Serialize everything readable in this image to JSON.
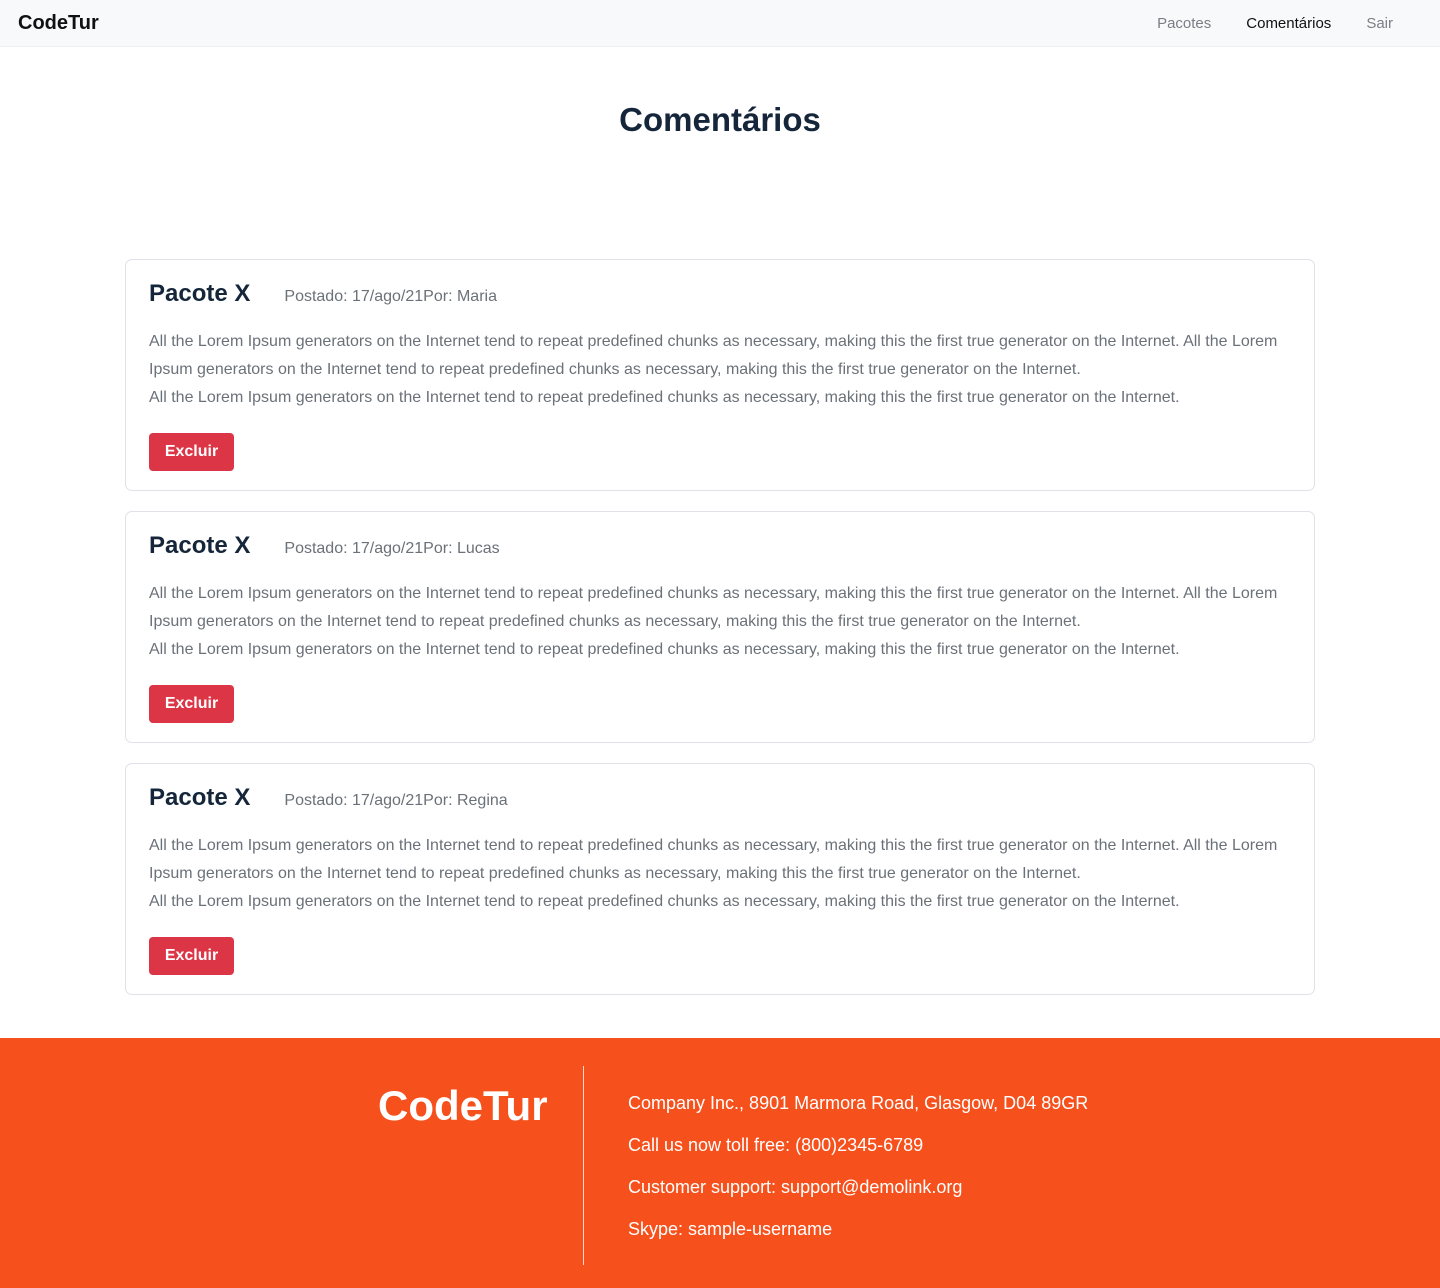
{
  "navbar": {
    "brand": "CodeTur",
    "links": [
      {
        "label": "Pacotes",
        "active": false
      },
      {
        "label": "Comentários",
        "active": true
      },
      {
        "label": "Sair",
        "active": false
      }
    ]
  },
  "page": {
    "title": "Comentários"
  },
  "comments": [
    {
      "title": "Pacote X",
      "posted": "Postado: 17/ago/21",
      "author": "Por: Maria",
      "body_1": "All the Lorem Ipsum generators on the Internet tend to repeat predefined chunks as necessary, making this the first true generator on the Internet. All the Lorem Ipsum generators on the Internet tend to repeat predefined chunks as necessary, making this the first true generator on the Internet.",
      "body_2": "All the Lorem Ipsum generators on the Internet tend to repeat predefined chunks as necessary, making this the first true generator on the Internet.",
      "delete_label": "Excluir"
    },
    {
      "title": "Pacote X",
      "posted": "Postado: 17/ago/21",
      "author": "Por: Lucas",
      "body_1": "All the Lorem Ipsum generators on the Internet tend to repeat predefined chunks as necessary, making this the first true generator on the Internet. All the Lorem Ipsum generators on the Internet tend to repeat predefined chunks as necessary, making this the first true generator on the Internet.",
      "body_2": "All the Lorem Ipsum generators on the Internet tend to repeat predefined chunks as necessary, making this the first true generator on the Internet.",
      "delete_label": "Excluir"
    },
    {
      "title": "Pacote X",
      "posted": "Postado: 17/ago/21",
      "author": "Por: Regina",
      "body_1": "All the Lorem Ipsum generators on the Internet tend to repeat predefined chunks as necessary, making this the first true generator on the Internet. All the Lorem Ipsum generators on the Internet tend to repeat predefined chunks as necessary, making this the first true generator on the Internet.",
      "body_2": "All the Lorem Ipsum generators on the Internet tend to repeat predefined chunks as necessary, making this the first true generator on the Internet.",
      "delete_label": "Excluir"
    }
  ],
  "footer": {
    "brand": "CodeTur",
    "address": "Company Inc., 8901 Marmora Road, Glasgow, D04 89GR",
    "phone": "Call us now toll free: (800)2345-6789",
    "support": "Customer support: support@demolink.org",
    "skype": "Skype: sample-username"
  },
  "colors": {
    "footer_bg": "#f6511d",
    "delete_button": "#dc3545",
    "navbar_bg": "#f8f9fa"
  }
}
